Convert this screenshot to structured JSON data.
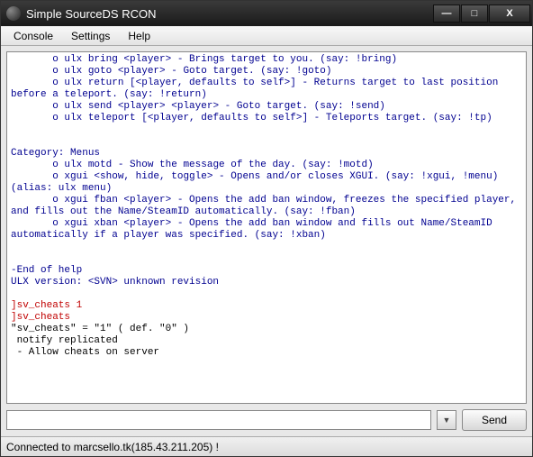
{
  "window": {
    "title": "Simple SourceDS RCON"
  },
  "menu": {
    "console": "Console",
    "settings": "Settings",
    "help": "Help"
  },
  "console": {
    "lines": [
      {
        "c": "blue",
        "t": "       o ulx bring <player> - Brings target to you. (say: !bring)"
      },
      {
        "c": "blue",
        "t": "       o ulx goto <player> - Goto target. (say: !goto)"
      },
      {
        "c": "blue",
        "t": "       o ulx return [<player, defaults to self>] - Returns target to last position before a teleport. (say: !return)"
      },
      {
        "c": "blue",
        "t": "       o ulx send <player> <player> - Goto target. (say: !send)"
      },
      {
        "c": "blue",
        "t": "       o ulx teleport [<player, defaults to self>] - Teleports target. (say: !tp)"
      },
      {
        "c": "blue",
        "t": ""
      },
      {
        "c": "blue",
        "t": ""
      },
      {
        "c": "blue",
        "t": "Category: Menus"
      },
      {
        "c": "blue",
        "t": "       o ulx motd - Show the message of the day. (say: !motd)"
      },
      {
        "c": "blue",
        "t": "       o xgui <show, hide, toggle> - Opens and/or closes XGUI. (say: !xgui, !menu) (alias: ulx menu)"
      },
      {
        "c": "blue",
        "t": "       o xgui fban <player> - Opens the add ban window, freezes the specified player, and fills out the Name/SteamID automatically. (say: !fban)"
      },
      {
        "c": "blue",
        "t": "       o xgui xban <player> - Opens the add ban window and fills out Name/SteamID automatically if a player was specified. (say: !xban)"
      },
      {
        "c": "blue",
        "t": ""
      },
      {
        "c": "blue",
        "t": ""
      },
      {
        "c": "blue",
        "t": "-End of help"
      },
      {
        "c": "blue",
        "t": "ULX version: <SVN> unknown revision"
      },
      {
        "c": "blue",
        "t": ""
      },
      {
        "c": "red",
        "t": "]sv_cheats 1"
      },
      {
        "c": "red",
        "t": "]sv_cheats"
      },
      {
        "c": "black",
        "t": "\"sv_cheats\" = \"1\" ( def. \"0\" )"
      },
      {
        "c": "black",
        "t": " notify replicated"
      },
      {
        "c": "black",
        "t": " - Allow cheats on server"
      },
      {
        "c": "black",
        "t": ""
      }
    ]
  },
  "input": {
    "value": "",
    "placeholder": ""
  },
  "buttons": {
    "send": "Send"
  },
  "status": {
    "text": "Connected to marcsello.tk(185.43.211.205) !"
  }
}
